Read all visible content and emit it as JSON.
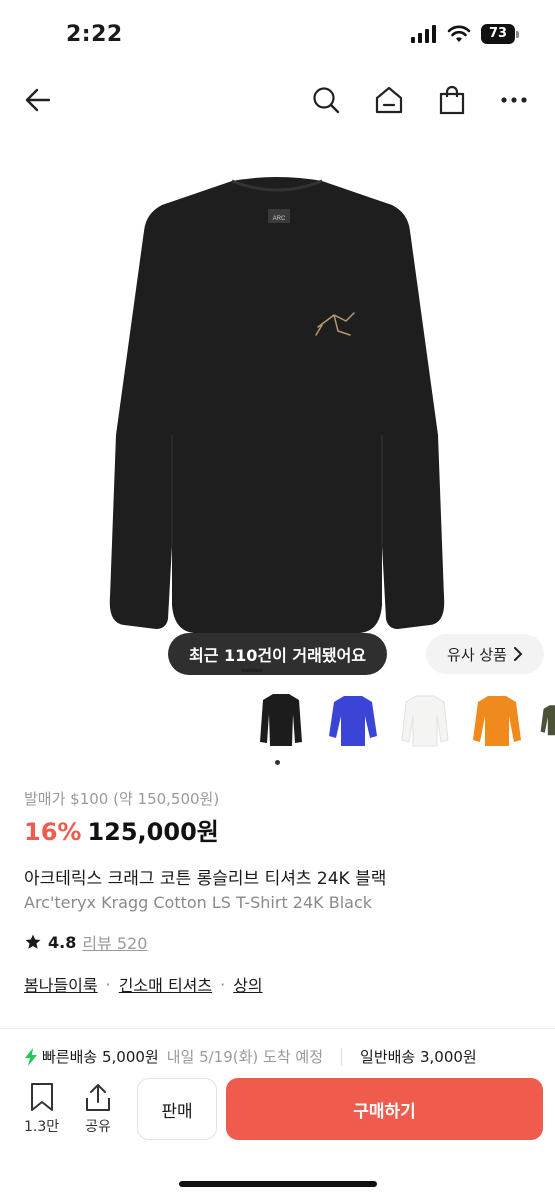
{
  "status_bar": {
    "time": "2:22",
    "battery": "73"
  },
  "nav": {
    "back_icon": "arrow-left-icon",
    "search_icon": "search-icon",
    "home_icon": "home-icon",
    "bag_icon": "shopping-bag-icon",
    "more_icon": "more-dots-icon"
  },
  "gallery": {
    "transactions_badge": "최근 110건이 거래됐어요",
    "similar_products": "유사 상품",
    "thumbnails": [
      {
        "color": "#1c1c1c"
      },
      {
        "color": "#3a45d8"
      },
      {
        "color": "#f4f4f2"
      },
      {
        "color": "#f08a1c"
      },
      {
        "color": "#4a5238"
      }
    ]
  },
  "product": {
    "release_price": "발매가 $100 (약 150,500원)",
    "discount": "16%",
    "price": "125,000원",
    "title_ko": "아크테릭스 크래그 코튼 롱슬리브 티셔츠 24K 블랙",
    "title_en": "Arc'teryx Kragg Cotton LS T-Shirt 24K Black",
    "rating": "4.8",
    "review_label": "리뷰 520",
    "tags": [
      "봄나들이룩",
      "긴소매 티셔츠",
      "상의"
    ]
  },
  "shipping": {
    "fast": "빠른배송 5,000원",
    "fast_eta": "내일 5/19(화) 도착 예정",
    "normal": "일반배송 3,000원"
  },
  "bottom_bar": {
    "bookmark_count": "1.3만",
    "share_label": "공유",
    "sell_label": "판매",
    "buy_label": "구매하기"
  },
  "colors": {
    "accent": "#ef5b4c",
    "fast_ship": "#22c55e"
  }
}
